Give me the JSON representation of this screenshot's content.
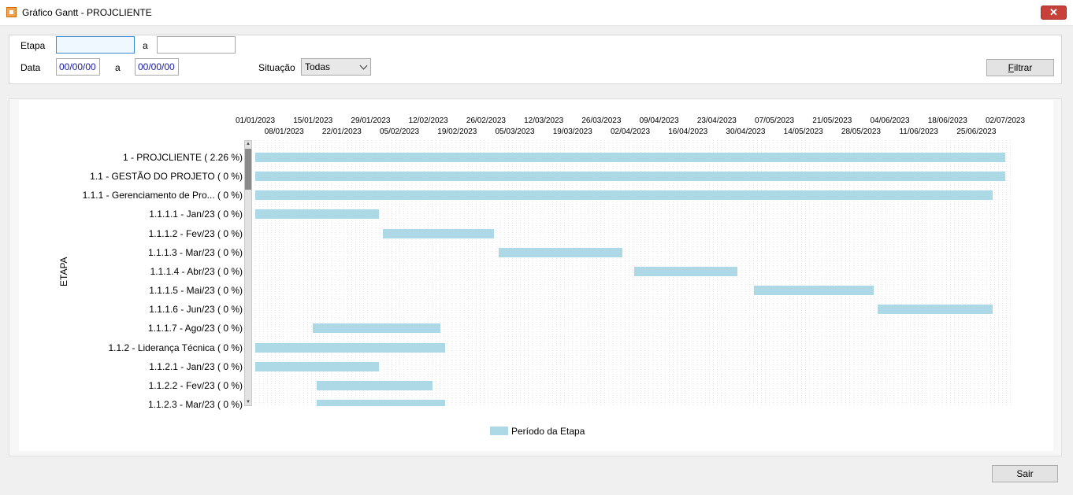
{
  "window": {
    "title": "Gráfico Gantt  - PROJCLIENTE",
    "close_label": "✕"
  },
  "filters": {
    "etapa_label": "Etapa",
    "etapa_from": "",
    "etapa_to_label": "a",
    "etapa_to": "",
    "data_label": "Data",
    "data_from": "00/00/00",
    "data_to_label": "a",
    "data_to": "00/00/00",
    "situacao_label": "Situação",
    "situacao_value": "Todas",
    "filtrar_label_accel": "F",
    "filtrar_label_rest": "iltrar"
  },
  "chart_data": {
    "type": "gantt",
    "ylabel": "ETAPA",
    "x_ticks_top": [
      "01/01/2023",
      "15/01/2023",
      "29/01/2023",
      "12/02/2023",
      "26/02/2023",
      "12/03/2023",
      "26/03/2023",
      "09/04/2023",
      "23/04/2023",
      "07/05/2023",
      "21/05/2023",
      "04/06/2023",
      "18/06/2023",
      "02/07/2023"
    ],
    "x_ticks_bottom": [
      "08/01/2023",
      "22/01/2023",
      "05/02/2023",
      "19/02/2023",
      "05/03/2023",
      "19/03/2023",
      "02/04/2023",
      "16/04/2023",
      "30/04/2023",
      "14/05/2023",
      "28/05/2023",
      "11/06/2023",
      "25/06/2023"
    ],
    "x_range": [
      "2023-01-01",
      "2023-07-02"
    ],
    "legend": "Período da Etapa",
    "tasks": [
      {
        "label": "1 - PROJCLIENTE  ( 2.26 %)",
        "start": "2023-01-01",
        "end": "2023-07-02"
      },
      {
        "label": "1.1 - GESTÃO DO PROJETO  ( 0 %)",
        "start": "2023-01-01",
        "end": "2023-07-02"
      },
      {
        "label": "1.1.1 - Gerenciamento de Pro...  ( 0 %)",
        "start": "2023-01-01",
        "end": "2023-06-29"
      },
      {
        "label": "1.1.1.1 - Jan/23  ( 0 %)",
        "start": "2023-01-01",
        "end": "2023-01-31"
      },
      {
        "label": "1.1.1.2 - Fev/23  ( 0 %)",
        "start": "2023-02-01",
        "end": "2023-02-28"
      },
      {
        "label": "1.1.1.3 - Mar/23  ( 0 %)",
        "start": "2023-03-01",
        "end": "2023-03-31"
      },
      {
        "label": "1.1.1.4 - Abr/23  ( 0 %)",
        "start": "2023-04-03",
        "end": "2023-04-28"
      },
      {
        "label": "1.1.1.5 - Mai/23  ( 0 %)",
        "start": "2023-05-02",
        "end": "2023-05-31"
      },
      {
        "label": "1.1.1.6 - Jun/23  ( 0 %)",
        "start": "2023-06-01",
        "end": "2023-06-29"
      },
      {
        "label": "1.1.1.7 - Ago/23  ( 0 %)",
        "start": "2023-01-15",
        "end": "2023-02-15"
      },
      {
        "label": "1.1.2 - Liderança Técnica  ( 0 %)",
        "start": "2023-01-01",
        "end": "2023-02-16"
      },
      {
        "label": "1.1.2.1 - Jan/23  ( 0 %)",
        "start": "2023-01-01",
        "end": "2023-01-31"
      },
      {
        "label": "1.1.2.2 - Fev/23  ( 0 %)",
        "start": "2023-01-16",
        "end": "2023-02-13"
      },
      {
        "label": "1.1.2.3 - Mar/23  ( 0 %)",
        "start": "2023-01-16",
        "end": "2023-02-16"
      }
    ]
  },
  "footer": {
    "sair_label": "Sair"
  }
}
